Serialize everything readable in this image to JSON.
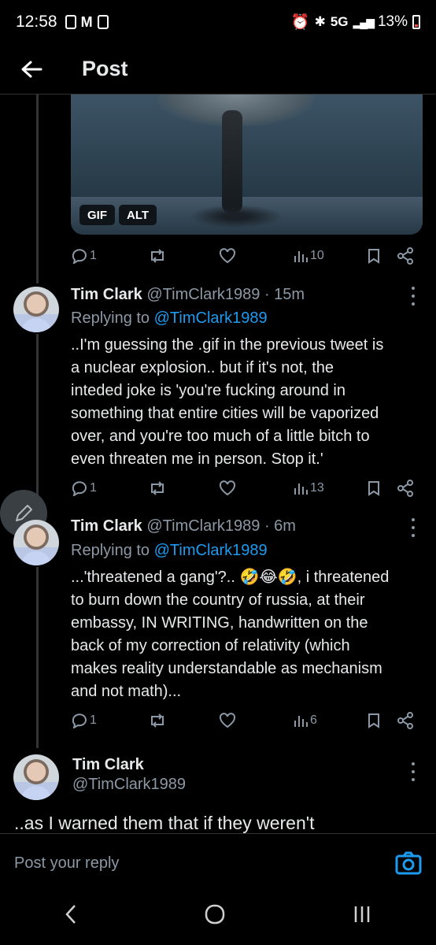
{
  "status_bar": {
    "time": "12:58",
    "network": "5G",
    "battery": "13%"
  },
  "header": {
    "title": "Post"
  },
  "media_post": {
    "badges": [
      "GIF",
      "ALT"
    ],
    "actions": {
      "replies": "1",
      "views": "10"
    }
  },
  "tweets": [
    {
      "name": "Tim Clark",
      "handle": "@TimClark1989",
      "time": "· 15m",
      "replying_prefix": "Replying to ",
      "replying_handle": "@TimClark1989",
      "lines": [
        "..I'm guessing the .gif in the previous tweet is",
        "a nuclear explosion.. but if it's not, the",
        "inteded joke is 'you're fucking around in",
        "something that entire cities will be vaporized",
        "over, and you're too much of a little bitch to",
        "even threaten me in person. Stop it.'"
      ],
      "replies": "1",
      "views": "13"
    },
    {
      "name": "Tim Clark",
      "handle": "@TimClark1989",
      "time": "· 6m",
      "replying_prefix": "Replying to ",
      "replying_handle": "@TimClark1989",
      "lines": [
        "...'threatened a gang'?.. 🤣😂🤣, i threatened",
        "to burn down the country of russia, at their",
        "embassy, IN WRITING, handwritten on the",
        "back of my correction of relativity (which",
        "makes reality understandable as mechanism",
        "and not math)..."
      ],
      "replies": "1",
      "views": "6"
    }
  ],
  "focused_tweet": {
    "name": "Tim Clark",
    "handle": "@TimClark1989",
    "text": "..as I warned them that if they weren't"
  },
  "reply_bar": {
    "placeholder": "Post your reply"
  },
  "colors": {
    "accent": "#1d9bf0",
    "muted": "#8b98a5",
    "text": "#e7e9ea"
  }
}
